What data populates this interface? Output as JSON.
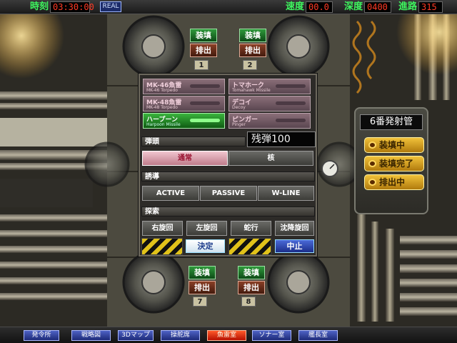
{
  "topbar": {
    "time_label": "時刻",
    "time_value": "03:30:00",
    "mode_badge": "REAL",
    "speed_label": "速度",
    "speed_value": "00.0",
    "depth_label": "深度",
    "depth_value": "0400",
    "course_label": "進路",
    "course_value": "315"
  },
  "tubes": [
    {
      "number": "1",
      "load_label": "装填",
      "unload_label": "排出"
    },
    {
      "number": "2",
      "load_label": "装填",
      "unload_label": "排出"
    },
    {
      "number": "7",
      "load_label": "装填",
      "unload_label": "排出"
    },
    {
      "number": "8",
      "load_label": "装填",
      "unload_label": "排出"
    }
  ],
  "weapons": [
    {
      "name": "MK-46魚雷",
      "en": "MK-46 Torpedo",
      "selected": false
    },
    {
      "name": "トマホーク",
      "en": "Tomahawk Missile",
      "selected": false
    },
    {
      "name": "MK-48魚雷",
      "en": "MK-48 Torpedo",
      "selected": false
    },
    {
      "name": "デコイ",
      "en": "Decoy",
      "selected": false
    },
    {
      "name": "ハープーン",
      "en": "Harpoon Missile",
      "selected": true
    },
    {
      "name": "ピンガー",
      "en": "Pinger",
      "selected": false
    }
  ],
  "ammo": "残弾100",
  "warhead": {
    "label": "弾頭",
    "options": [
      "通常",
      "核"
    ],
    "selected": "通常"
  },
  "guidance": {
    "label": "誘導",
    "options": [
      "ACTIVE",
      "PASSIVE",
      "W-LINE"
    ]
  },
  "search": {
    "label": "探索",
    "options": [
      "右旋回",
      "左旋回",
      "蛇行",
      "沈降旋回"
    ]
  },
  "actions": {
    "confirm": "決定",
    "cancel": "中止"
  },
  "tube_status": {
    "title": "6番発射管",
    "items": [
      "装填中",
      "装填完了",
      "排出中"
    ]
  },
  "nav": [
    "発令所",
    "戦略図",
    "3Dマップ",
    "操舵席",
    "魚雷室",
    "ソナー室",
    "艦長室"
  ],
  "nav_active": "魚雷室",
  "colors": {
    "indicator_green": "#3ef55e",
    "readout_red": "#ff3a24",
    "nav_blue": "#2d3fa0",
    "nav_active": "#e03a10",
    "status_amber": "#e0a521",
    "selected_green": "#2a9a2e"
  }
}
